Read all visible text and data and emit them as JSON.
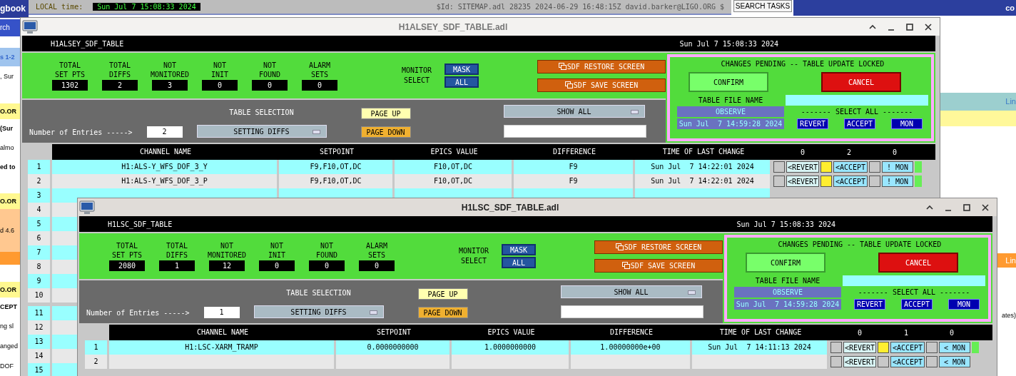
{
  "backdrop": {
    "sitemap": {
      "time_label": "LOCAL time:",
      "time_value": "Sun Jul  7 15:08:33 2024",
      "id_text": "$Id: SITEMAP.adl 28235 2024-06-29 16:48:15Z david.barker@LIGO.ORG $",
      "search_button": "SEARCH TASKS"
    },
    "logbook": [
      {
        "text": "gbook",
        "kind": "title"
      },
      {
        "text": "rch",
        "kind": "nav"
      },
      {
        "text": "s 1-2",
        "kind": "pager"
      },
      {
        "text": ", Sur",
        "kind": "plain"
      },
      {
        "text": "O.OR",
        "kind": "yellow"
      },
      {
        "text": "(Sur",
        "kind": "bold"
      },
      {
        "text": "almo",
        "kind": "plain"
      },
      {
        "text": "ed to",
        "kind": "bold"
      },
      {
        "text": "O.OR",
        "kind": "yellow"
      },
      {
        "text": "d 4.6",
        "kind": "orange"
      },
      {
        "text": "O.OR",
        "kind": "yellow"
      },
      {
        "text": "CEPT",
        "kind": "bold"
      },
      {
        "text": "ng sl",
        "kind": "plain"
      },
      {
        "text": "anged",
        "kind": "plain"
      },
      {
        "text": "DOF",
        "kind": "plain"
      }
    ],
    "corner_text": "co",
    "side": [
      {
        "text": "Lin",
        "kind": "teal"
      },
      {
        "text": "Lin",
        "kind": "orange"
      },
      {
        "text": "ates)",
        "kind": "plain"
      }
    ]
  },
  "windows": [
    {
      "title": "H1ALSEY_SDF_TABLE.adl",
      "active": false,
      "screen_name": "H1ALSEY_SDF_TABLE",
      "clock": "Sun Jul  7 15:08:33 2024",
      "stats": [
        {
          "label": "TOTAL\nSET PTS",
          "value": "1302"
        },
        {
          "label": "TOTAL\nDIFFS",
          "value": "2"
        },
        {
          "label": "NOT\nMONITORED",
          "value": "3"
        },
        {
          "label": "NOT\nINIT",
          "value": "0"
        },
        {
          "label": "NOT\nFOUND",
          "value": "0"
        },
        {
          "label": "ALARM\nSETS",
          "value": "0"
        }
      ],
      "monitor_select": {
        "label": "MONITOR\nSELECT",
        "options": [
          "MASK",
          "ALL"
        ]
      },
      "screen_buttons": [
        "SDF RESTORE SCREEN",
        "SDF SAVE SCREEN"
      ],
      "entries_label": "Number of Entries ----->",
      "entries_value": "2",
      "table_selection_label": "TABLE SELECTION",
      "table_menu": "SETTING DIFFS",
      "page_buttons": [
        "PAGE UP",
        "PAGE DOWN"
      ],
      "show_menu": "SHOW ALL",
      "pending": {
        "heading": "CHANGES PENDING -- TABLE UPDATE LOCKED",
        "confirm": "CONFIRM",
        "cancel": "CANCEL",
        "file_label": "TABLE FILE NAME",
        "mode": "OBSERVE",
        "loaded": "Sun Jul  7 14:59:28 2024",
        "select_all_label": "------- SELECT ALL -------",
        "select_all_buttons": [
          "REVERT",
          "ACCEPT",
          "MON"
        ]
      },
      "columns": [
        "CHANNEL NAME",
        "SETPOINT",
        "EPICS VALUE",
        "DIFFERENCE",
        "TIME OF LAST CHANGE"
      ],
      "counts": [
        "0",
        "2",
        "0"
      ],
      "rows": [
        {
          "number": "1",
          "channel": "H1:ALS-Y_WFS_DOF_3_Y",
          "setpoint": "F9,F10,OT,DC",
          "epics_value": "F10,OT,DC",
          "difference": "F9",
          "time": "Sun Jul  7 14:22:01 2024",
          "controls": {
            "revert": "<REVERT",
            "revert_checked": false,
            "accept": "<ACCEPT",
            "accept_checked": true,
            "mon": "! MON",
            "mon_checked": false,
            "monitored": true
          }
        },
        {
          "number": "2",
          "channel": "H1:ALS-Y_WFS_DOF_3_P",
          "setpoint": "F9,F10,OT,DC",
          "epics_value": "F10,OT,DC",
          "difference": "F9",
          "time": "Sun Jul  7 14:22:01 2024",
          "controls": {
            "revert": "<REVERT",
            "revert_checked": false,
            "accept": "<ACCEPT",
            "accept_checked": true,
            "mon": "! MON",
            "mon_checked": false,
            "monitored": true
          }
        },
        {
          "number": "3"
        },
        {
          "number": "4"
        },
        {
          "number": "5"
        },
        {
          "number": "6"
        },
        {
          "number": "7"
        },
        {
          "number": "8"
        },
        {
          "number": "9"
        },
        {
          "number": "10"
        },
        {
          "number": "11"
        },
        {
          "number": "12"
        },
        {
          "number": "13"
        },
        {
          "number": "14"
        },
        {
          "number": "15"
        }
      ]
    },
    {
      "title": "H1LSC_SDF_TABLE.adl",
      "active": true,
      "screen_name": "H1LSC_SDF_TABLE",
      "clock": "Sun Jul  7 15:08:33 2024",
      "stats": [
        {
          "label": "TOTAL\nSET PTS",
          "value": "2080"
        },
        {
          "label": "TOTAL\nDIFFS",
          "value": "1"
        },
        {
          "label": "NOT\nMONITORED",
          "value": "12"
        },
        {
          "label": "NOT\nINIT",
          "value": "0"
        },
        {
          "label": "NOT\nFOUND",
          "value": "0"
        },
        {
          "label": "ALARM\nSETS",
          "value": "0"
        }
      ],
      "monitor_select": {
        "label": "MONITOR\nSELECT",
        "options": [
          "MASK",
          "ALL"
        ]
      },
      "screen_buttons": [
        "SDF RESTORE SCREEN",
        "SDF SAVE SCREEN"
      ],
      "entries_label": "Number of Entries ----->",
      "entries_value": "1",
      "table_selection_label": "TABLE SELECTION",
      "table_menu": "SETTING DIFFS",
      "page_buttons": [
        "PAGE UP",
        "PAGE DOWN"
      ],
      "show_menu": "SHOW ALL",
      "pending": {
        "heading": "CHANGES PENDING -- TABLE UPDATE LOCKED",
        "confirm": "CONFIRM",
        "cancel": "CANCEL",
        "file_label": "TABLE FILE NAME",
        "mode": "OBSERVE",
        "loaded": "Sun Jul  7 14:59:28 2024",
        "select_all_label": "------- SELECT ALL -------",
        "select_all_buttons": [
          "REVERT",
          "ACCEPT",
          "MON"
        ]
      },
      "columns": [
        "CHANNEL NAME",
        "SETPOINT",
        "EPICS VALUE",
        "DIFFERENCE",
        "TIME OF LAST CHANGE"
      ],
      "counts": [
        "0",
        "1",
        "0"
      ],
      "rows": [
        {
          "number": "1",
          "channel": "H1:LSC-XARM_TRAMP",
          "setpoint": "0.0000000000",
          "epics_value": "1.0000000000",
          "difference": "1.00000000e+00",
          "time": "Sun Jul  7 14:11:13 2024",
          "controls": {
            "revert": "<REVERT",
            "revert_checked": false,
            "accept": "<ACCEPT",
            "accept_checked": true,
            "mon": "< MON",
            "mon_checked": false,
            "monitored": true
          }
        },
        {
          "number": "2",
          "controls": {
            "revert": "<REVERT",
            "revert_checked": false,
            "accept": "<ACCEPT",
            "accept_checked": false,
            "mon": "< MON",
            "mon_checked": false,
            "monitored": false
          }
        }
      ]
    }
  ]
}
